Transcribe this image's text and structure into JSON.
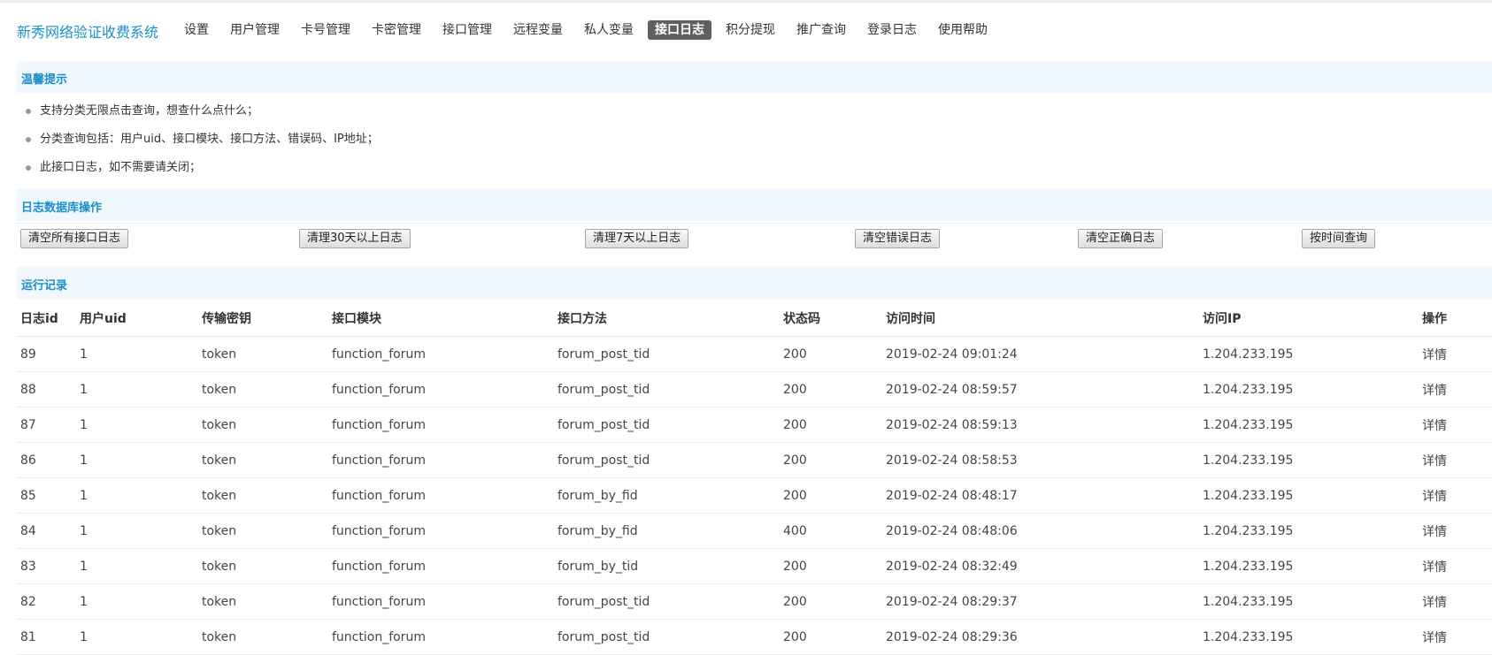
{
  "header": {
    "brand": "新秀网络验证收费系统",
    "nav": [
      {
        "label": "设置",
        "active": false
      },
      {
        "label": "用户管理",
        "active": false
      },
      {
        "label": "卡号管理",
        "active": false
      },
      {
        "label": "卡密管理",
        "active": false
      },
      {
        "label": "接口管理",
        "active": false
      },
      {
        "label": "远程变量",
        "active": false
      },
      {
        "label": "私人变量",
        "active": false
      },
      {
        "label": "接口日志",
        "active": true
      },
      {
        "label": "积分提现",
        "active": false
      },
      {
        "label": "推广查询",
        "active": false
      },
      {
        "label": "登录日志",
        "active": false
      },
      {
        "label": "使用帮助",
        "active": false
      }
    ]
  },
  "tips": {
    "title": "温馨提示",
    "items": [
      "支持分类无限点击查询，想查什么点什么；",
      "分类查询包括：用户uid、接口模块、接口方法、错误码、IP地址；",
      "此接口日志，如不需要请关闭；"
    ]
  },
  "db_ops": {
    "title": "日志数据库操作",
    "buttons": [
      "清空所有接口日志",
      "清理30天以上日志",
      "清理7天以上日志",
      "清空错误日志",
      "清空正确日志",
      "按时间查询"
    ]
  },
  "log": {
    "title": "运行记录",
    "columns": [
      "日志id",
      "用户uid",
      "传输密钥",
      "接口模块",
      "接口方法",
      "状态码",
      "访问时间",
      "访问IP",
      "操作"
    ],
    "rows": [
      {
        "id": "89",
        "uid": "1",
        "key": "token",
        "module": "function_forum",
        "method": "forum_post_tid",
        "status": "200",
        "time": "2019-02-24 09:01:24",
        "ip": "1.204.233.195",
        "action": "详情"
      },
      {
        "id": "88",
        "uid": "1",
        "key": "token",
        "module": "function_forum",
        "method": "forum_post_tid",
        "status": "200",
        "time": "2019-02-24 08:59:57",
        "ip": "1.204.233.195",
        "action": "详情"
      },
      {
        "id": "87",
        "uid": "1",
        "key": "token",
        "module": "function_forum",
        "method": "forum_post_tid",
        "status": "200",
        "time": "2019-02-24 08:59:13",
        "ip": "1.204.233.195",
        "action": "详情"
      },
      {
        "id": "86",
        "uid": "1",
        "key": "token",
        "module": "function_forum",
        "method": "forum_post_tid",
        "status": "200",
        "time": "2019-02-24 08:58:53",
        "ip": "1.204.233.195",
        "action": "详情"
      },
      {
        "id": "85",
        "uid": "1",
        "key": "token",
        "module": "function_forum",
        "method": "forum_by_fid",
        "status": "200",
        "time": "2019-02-24 08:48:17",
        "ip": "1.204.233.195",
        "action": "详情"
      },
      {
        "id": "84",
        "uid": "1",
        "key": "token",
        "module": "function_forum",
        "method": "forum_by_fid",
        "status": "400",
        "time": "2019-02-24 08:48:06",
        "ip": "1.204.233.195",
        "action": "详情"
      },
      {
        "id": "83",
        "uid": "1",
        "key": "token",
        "module": "function_forum",
        "method": "forum_by_tid",
        "status": "200",
        "time": "2019-02-24 08:32:49",
        "ip": "1.204.233.195",
        "action": "详情"
      },
      {
        "id": "82",
        "uid": "1",
        "key": "token",
        "module": "function_forum",
        "method": "forum_post_tid",
        "status": "200",
        "time": "2019-02-24 08:29:37",
        "ip": "1.204.233.195",
        "action": "详情"
      },
      {
        "id": "81",
        "uid": "1",
        "key": "token",
        "module": "function_forum",
        "method": "forum_post_tid",
        "status": "200",
        "time": "2019-02-24 08:29:36",
        "ip": "1.204.233.195",
        "action": "详情"
      }
    ]
  },
  "colors": {
    "brand": "#1b8fc7",
    "link": "#2c6aa0",
    "status_ok": "#1f8a1f",
    "status_error": "#d42a2a",
    "active_tab": "#5f5f5f",
    "section_bg": "#f1f8fd"
  }
}
